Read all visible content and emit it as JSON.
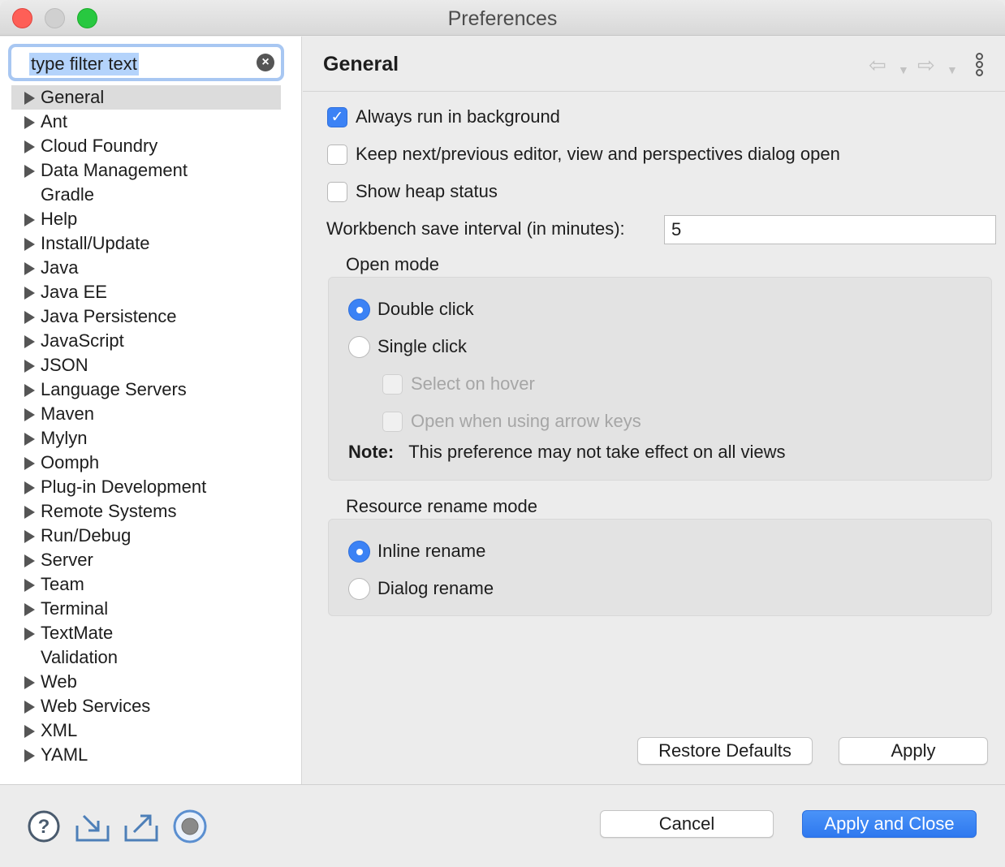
{
  "window": {
    "title": "Preferences"
  },
  "filter": {
    "value": "type filter text",
    "clear_icon": "clear-circle-icon"
  },
  "tree": {
    "items": [
      {
        "label": "General",
        "expandable": true,
        "selected": true
      },
      {
        "label": "Ant",
        "expandable": true
      },
      {
        "label": "Cloud Foundry",
        "expandable": true
      },
      {
        "label": "Data Management",
        "expandable": true
      },
      {
        "label": "Gradle",
        "expandable": false
      },
      {
        "label": "Help",
        "expandable": true
      },
      {
        "label": "Install/Update",
        "expandable": true
      },
      {
        "label": "Java",
        "expandable": true
      },
      {
        "label": "Java EE",
        "expandable": true
      },
      {
        "label": "Java Persistence",
        "expandable": true
      },
      {
        "label": "JavaScript",
        "expandable": true
      },
      {
        "label": "JSON",
        "expandable": true
      },
      {
        "label": "Language Servers",
        "expandable": true
      },
      {
        "label": "Maven",
        "expandable": true
      },
      {
        "label": "Mylyn",
        "expandable": true
      },
      {
        "label": "Oomph",
        "expandable": true
      },
      {
        "label": "Plug-in Development",
        "expandable": true
      },
      {
        "label": "Remote Systems",
        "expandable": true
      },
      {
        "label": "Run/Debug",
        "expandable": true
      },
      {
        "label": "Server",
        "expandable": true
      },
      {
        "label": "Team",
        "expandable": true
      },
      {
        "label": "Terminal",
        "expandable": true
      },
      {
        "label": "TextMate",
        "expandable": true
      },
      {
        "label": "Validation",
        "expandable": false
      },
      {
        "label": "Web",
        "expandable": true
      },
      {
        "label": "Web Services",
        "expandable": true
      },
      {
        "label": "XML",
        "expandable": true
      },
      {
        "label": "YAML",
        "expandable": true
      }
    ]
  },
  "page": {
    "title": "General",
    "options": {
      "always_run": "Always run in background",
      "keep_dialog": "Keep next/previous editor, view and perspectives dialog open",
      "show_heap": "Show heap status"
    },
    "save_interval_label": "Workbench save interval (in minutes):",
    "save_interval_value": "5",
    "open_mode": {
      "label": "Open mode",
      "double_click": "Double click",
      "single_click": "Single click",
      "select_hover": "Select on hover",
      "open_arrow": "Open when using arrow keys",
      "note_key": "Note:",
      "note_text": "This preference may not take effect on all views"
    },
    "rename_mode": {
      "label": "Resource rename mode",
      "inline": "Inline rename",
      "dialog": "Dialog rename"
    },
    "restore_defaults": "Restore Defaults",
    "apply": "Apply"
  },
  "footer": {
    "cancel": "Cancel",
    "apply_close": "Apply and Close",
    "icons": [
      "help-icon",
      "import-icon",
      "export-icon",
      "oomph-record-icon"
    ]
  },
  "colors": {
    "accent": "#3b82f5",
    "close": "#fe5f57",
    "maximize": "#28c840"
  }
}
